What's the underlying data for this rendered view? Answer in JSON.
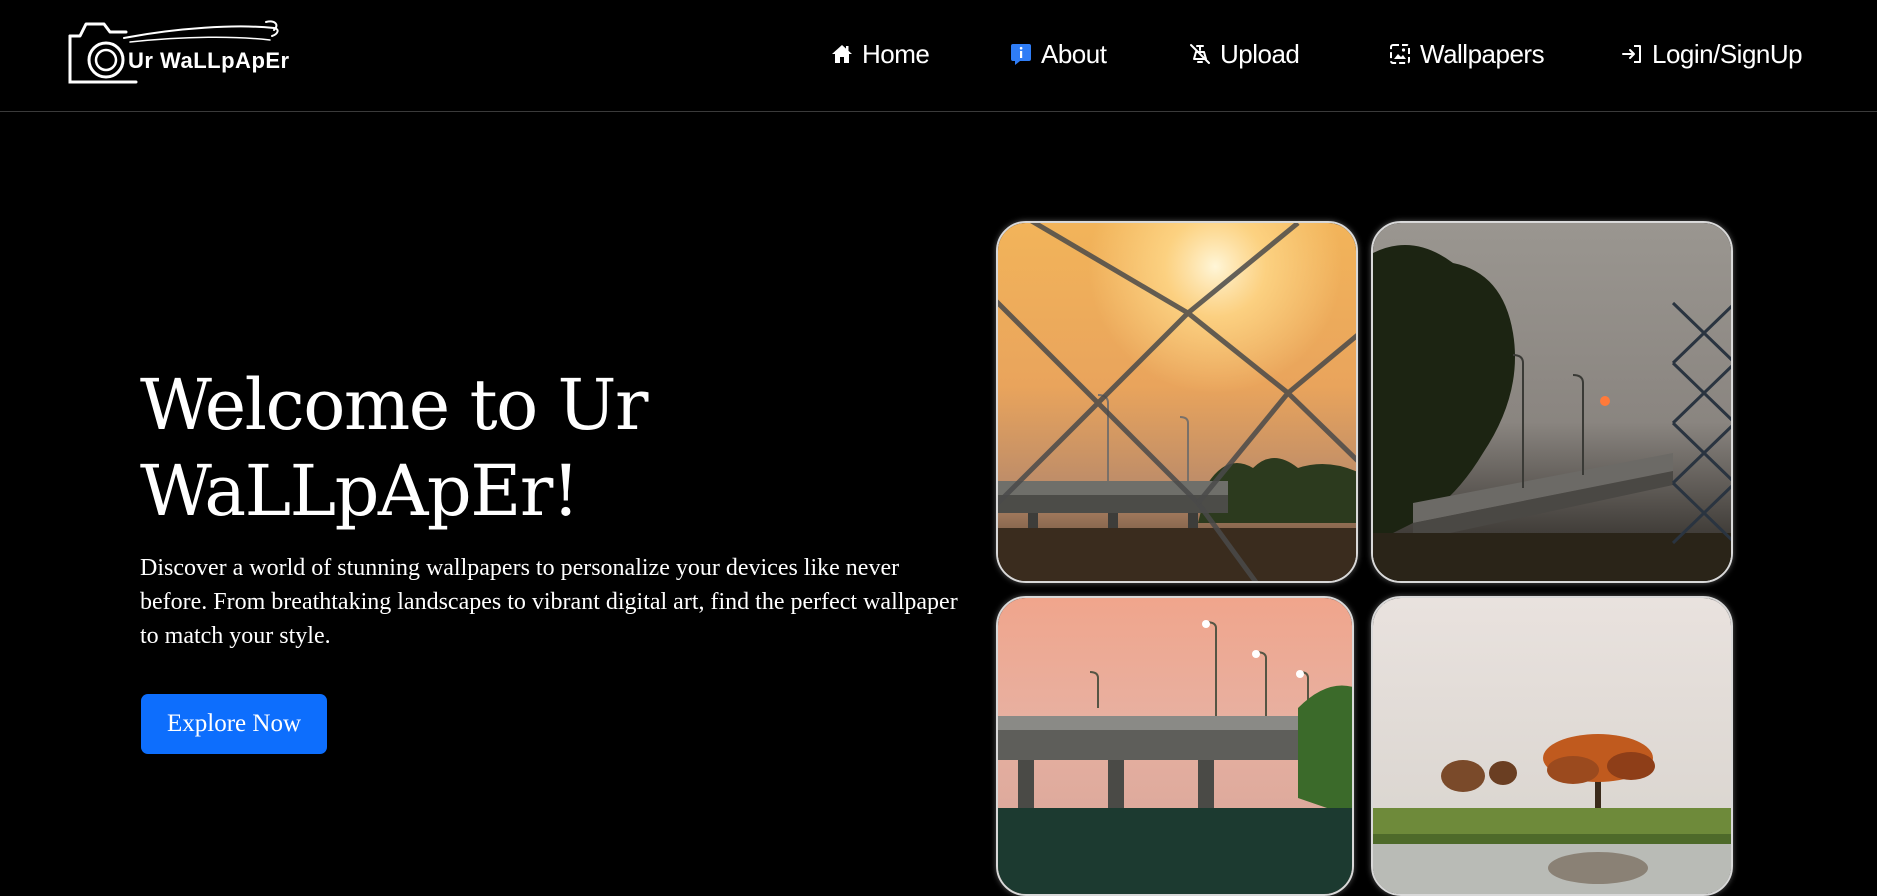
{
  "header": {
    "logo_text": "Ur WaLLpApEr",
    "nav": [
      {
        "label": "Home",
        "icon": "home-icon"
      },
      {
        "label": "About",
        "icon": "info-icon"
      },
      {
        "label": "Upload",
        "icon": "upload-icon"
      },
      {
        "label": "Wallpapers",
        "icon": "image-icon"
      },
      {
        "label": "Login/SignUp",
        "icon": "login-icon"
      }
    ]
  },
  "hero": {
    "title": "Welcome to Ur WaLLpApEr!",
    "description": "Discover a world of stunning wallpapers to personalize your devices like never before. From breathtaking landscapes to vibrant digital art, find the perfect wallpaper to match your style.",
    "cta_label": "Explore Now"
  },
  "gallery": {
    "images": [
      "sunset-fence-bridge-photo",
      "dusk-bridge-trees-photo",
      "pink-sky-bridge-photo",
      "tree-lake-photo"
    ]
  },
  "colors": {
    "background": "#000000",
    "accent": "#0d6efd",
    "text": "#ffffff",
    "about_icon": "#2f7df6"
  }
}
